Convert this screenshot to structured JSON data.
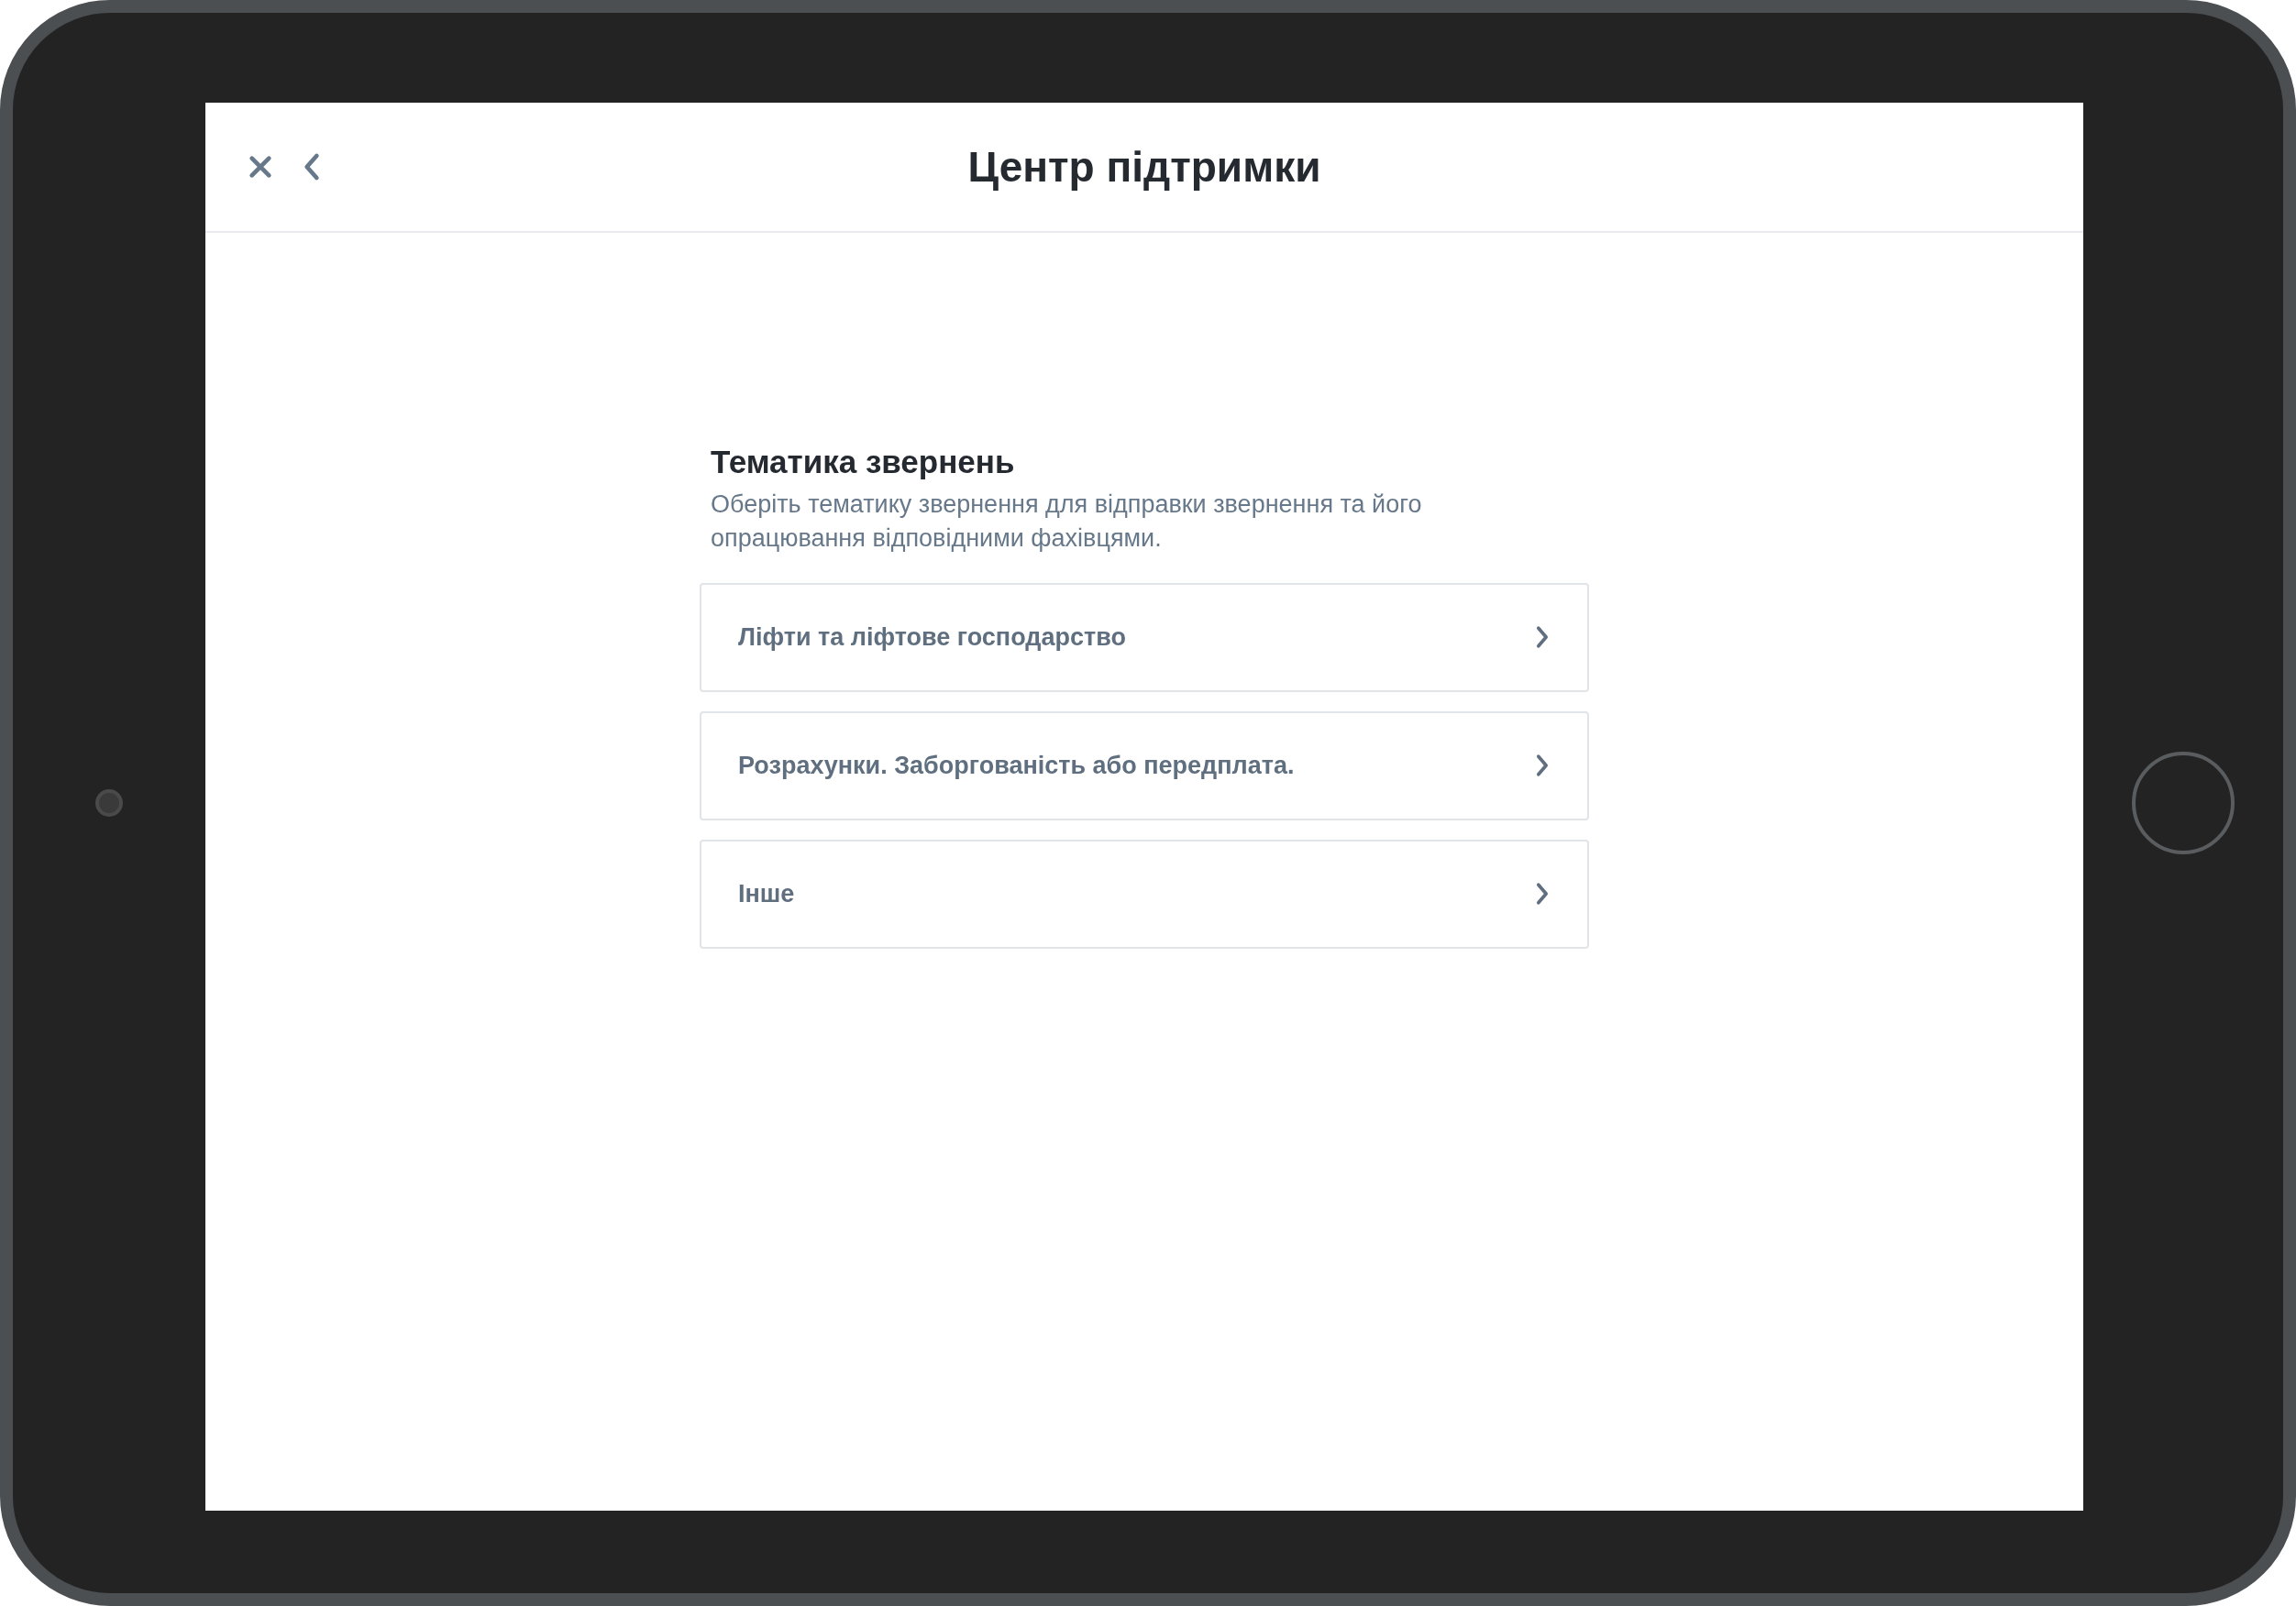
{
  "header": {
    "title": "Центр підтримки"
  },
  "section": {
    "title": "Тематика звернень",
    "description": "Оберіть тематику звернення для відправки звернення та його опрацювання відповідними фахівцями."
  },
  "topics": [
    {
      "label": "Ліфти та ліфтове господарство"
    },
    {
      "label": "Розрахунки. Заборгованість або передплата."
    },
    {
      "label": "Інше"
    }
  ]
}
